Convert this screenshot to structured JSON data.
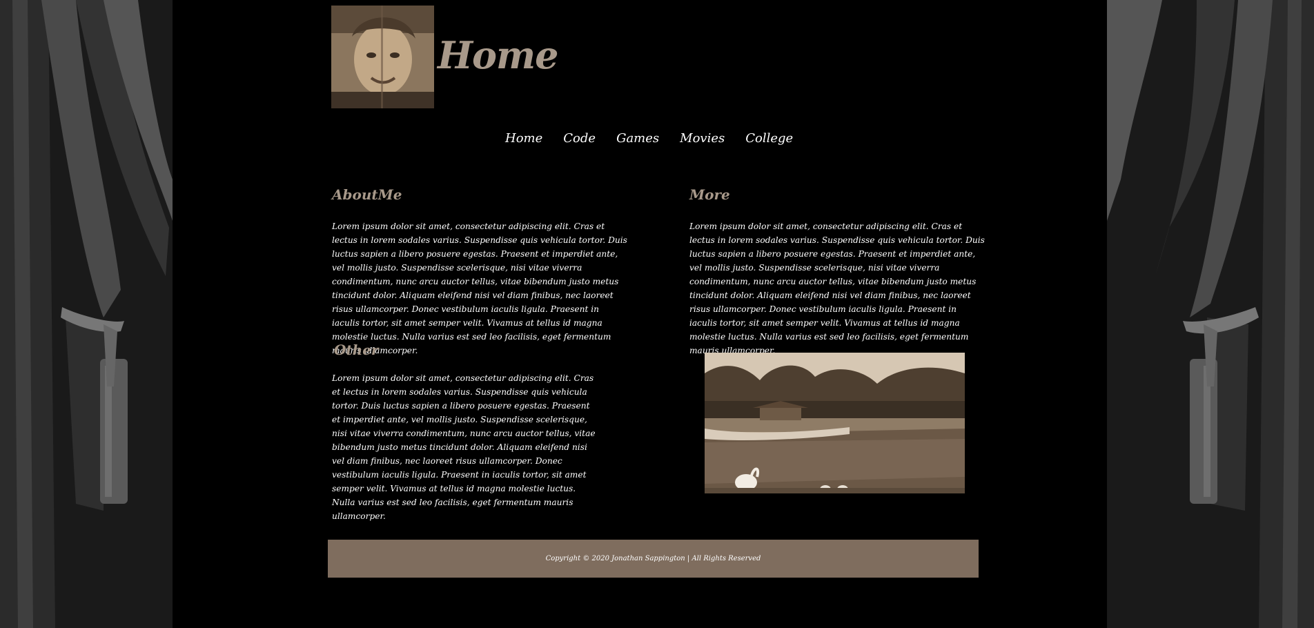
{
  "header": {
    "title": "Home",
    "avatar_alt": "portrait photo"
  },
  "nav": {
    "items": [
      {
        "label": "Home"
      },
      {
        "label": "Code"
      },
      {
        "label": "Games"
      },
      {
        "label": "Movies"
      },
      {
        "label": "College"
      }
    ]
  },
  "sections": {
    "about": {
      "title": "AboutMe",
      "text": "Lorem ipsum dolor sit amet, consectetur adipiscing elit. Cras et lectus in lorem sodales varius. Suspendisse quis vehicula tortor. Duis luctus sapien a libero posuere egestas. Praesent et imperdiet ante, vel mollis justo. Suspendisse scelerisque, nisi vitae viverra condimentum, nunc arcu auctor tellus, vitae bibendum justo metus tincidunt dolor. Aliquam eleifend nisi vel diam finibus, nec laoreet risus ullamcorper. Donec vestibulum iaculis ligula. Praesent in iaculis tortor, sit amet semper velit. Vivamus at tellus id magna molestie luctus. Nulla varius est sed leo facilisis, eget fermentum mauris ullamcorper."
    },
    "more": {
      "title": "More",
      "text": "Lorem ipsum dolor sit amet, consectetur adipiscing elit. Cras et lectus in lorem sodales varius. Suspendisse quis vehicula tortor. Duis luctus sapien a libero posuere egestas. Praesent et imperdiet ante, vel mollis justo. Suspendisse scelerisque, nisi vitae viverra condimentum, nunc arcu auctor tellus, vitae bibendum justo metus tincidunt dolor. Aliquam eleifend nisi vel diam finibus, nec laoreet risus ullamcorper. Donec vestibulum iaculis ligula. Praesent in iaculis tortor, sit amet semper velit. Vivamus at tellus id magna molestie luctus. Nulla varius est sed leo facilisis, eget fermentum mauris ullamcorper."
    },
    "other": {
      "title": "Other",
      "text": "Lorem ipsum dolor sit amet, consectetur adipiscing elit. Cras et lectus in lorem sodales varius. Suspendisse quis vehicula tortor. Duis luctus sapien a libero posuere egestas. Praesent et imperdiet ante, vel mollis justo. Suspendisse scelerisque, nisi vitae viverra condimentum, nunc arcu auctor tellus, vitae bibendum justo metus tincidunt dolor. Aliquam eleifend nisi vel diam finibus, nec laoreet risus ullamcorper. Donec vestibulum iaculis ligula. Praesent in iaculis tortor, sit amet semper velit. Vivamus at tellus id magna molestie luctus. Nulla varius est sed leo facilisis, eget fermentum mauris ullamcorper."
    }
  },
  "footer": {
    "copyright": "Copyright © 2020 Jonathan Sappington | All Rights Reserved"
  },
  "colors": {
    "background": "#000000",
    "heading": "#a8998a",
    "footer_bg": "#7f6d5e",
    "text": "#ffffff"
  }
}
